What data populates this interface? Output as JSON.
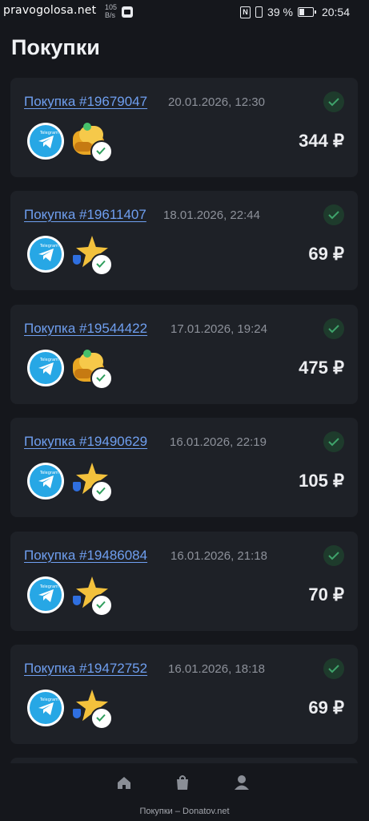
{
  "status_bar": {
    "watermark": "pravogolosa.net",
    "net_speed": "105",
    "net_unit": "B/s",
    "battery_percent": "39 %",
    "time": "20:54"
  },
  "page": {
    "title": "Покупки"
  },
  "purchases": [
    {
      "label": "Покупка #19679047",
      "date": "20.01.2026, 12:30",
      "price": "344 ₽",
      "product_icon": "gold-coins"
    },
    {
      "label": "Покупка #19611407",
      "date": "18.01.2026, 22:44",
      "price": "69 ₽",
      "product_icon": "gold-star"
    },
    {
      "label": "Покупка #19544422",
      "date": "17.01.2026, 19:24",
      "price": "475 ₽",
      "product_icon": "gold-coins"
    },
    {
      "label": "Покупка #19490629",
      "date": "16.01.2026, 22:19",
      "price": "105 ₽",
      "product_icon": "gold-star"
    },
    {
      "label": "Покупка #19486084",
      "date": "16.01.2026, 21:18",
      "price": "70 ₽",
      "product_icon": "gold-star"
    },
    {
      "label": "Покупка #19472752",
      "date": "16.01.2026, 18:18",
      "price": "69 ₽",
      "product_icon": "gold-star"
    }
  ],
  "telegram_logo_text": "Telegram",
  "bottom_nav": {
    "items": [
      "home-icon",
      "shopping-bag-icon",
      "profile-icon"
    ]
  },
  "footer": {
    "url_text": "Покупки – Donatov.net"
  },
  "colors": {
    "background": "#15171c",
    "card": "#1e2127",
    "link": "#6f9ff0",
    "success": "#3fa36b"
  }
}
